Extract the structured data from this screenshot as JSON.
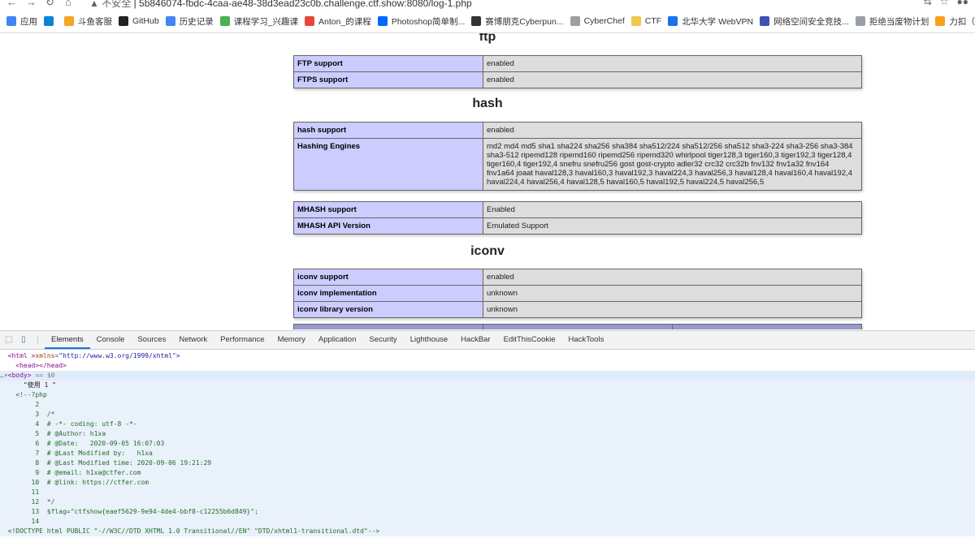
{
  "browser": {
    "security_label": "不安全",
    "url": "5b846074-fbdc-4caa-ae48-38d3ead23c0b.challenge.ctf.show:8080/log-1.php"
  },
  "bookmarks": [
    {
      "label": "应用",
      "icon": "apps-grid-icon",
      "color": "#4285f4"
    },
    {
      "label": "",
      "icon": "bing-icon",
      "color": "#0a84d6"
    },
    {
      "label": "斗鱼客服",
      "icon": "douyu-icon",
      "color": "#f5a623"
    },
    {
      "label": "GitHub",
      "icon": "github-icon",
      "color": "#222222"
    },
    {
      "label": "历史记录",
      "icon": "history-icon",
      "color": "#4285f4"
    },
    {
      "label": "课程学习_兴趣课",
      "icon": "course-icon",
      "color": "#4caf50"
    },
    {
      "label": "Anton_的课程",
      "icon": "flame-icon",
      "color": "#e8453c"
    },
    {
      "label": "Photoshop简单制...",
      "icon": "zhihu-icon",
      "color": "#0066ff"
    },
    {
      "label": "赛博朋克Cyberpun...",
      "icon": "cyberpunk-icon",
      "color": "#333333"
    },
    {
      "label": "CyberChef",
      "icon": "cyberchef-icon",
      "color": "#9aa0a6"
    },
    {
      "label": "CTF",
      "icon": "folder-icon",
      "color": "#f2c94c"
    },
    {
      "label": "北华大学 WebVPN",
      "icon": "lock-icon",
      "color": "#1a73e8"
    },
    {
      "label": "网络空间安全竞技...",
      "icon": "shield-icon",
      "color": "#3f51b5"
    },
    {
      "label": "拒绝当废物计划",
      "icon": "page-icon",
      "color": "#9aa0a6"
    },
    {
      "label": "力扣（LeetCode",
      "icon": "leetcode-icon",
      "color": "#f89f1b"
    }
  ],
  "php_info": {
    "ftp": {
      "title": "ftp",
      "rows": [
        {
          "name": "FTP support",
          "value": "enabled"
        },
        {
          "name": "FTPS support",
          "value": "enabled"
        }
      ]
    },
    "hash": {
      "title": "hash",
      "rows": [
        {
          "name": "hash support",
          "value": "enabled"
        },
        {
          "name": "Hashing Engines",
          "value": "md2 md4 md5 sha1 sha224 sha256 sha384 sha512/224 sha512/256 sha512 sha3-224 sha3-256 sha3-384 sha3-512 ripemd128 ripemd160 ripemd256 ripemd320 whirlpool tiger128,3 tiger160,3 tiger192,3 tiger128,4 tiger160,4 tiger192,4 snefru snefru256 gost gost-crypto adler32 crc32 crc32b fnv132 fnv1a32 fnv164 fnv1a64 joaat haval128,3 haval160,3 haval192,3 haval224,3 haval256,3 haval128,4 haval160,4 haval192,4 haval224,4 haval256,4 haval128,5 haval160,5 haval192,5 haval224,5 haval256,5"
        }
      ],
      "mhash_rows": [
        {
          "name": "MHASH support",
          "value": "Enabled"
        },
        {
          "name": "MHASH API Version",
          "value": "Emulated Support"
        }
      ]
    },
    "iconv": {
      "title": "iconv",
      "rows": [
        {
          "name": "iconv support",
          "value": "enabled"
        },
        {
          "name": "iconv implementation",
          "value": "unknown"
        },
        {
          "name": "iconv library version",
          "value": "unknown"
        }
      ]
    }
  },
  "devtools": {
    "tabs": [
      "Elements",
      "Console",
      "Sources",
      "Network",
      "Performance",
      "Memory",
      "Application",
      "Security",
      "Lighthouse",
      "HackBar",
      "EditThisCookie",
      "HackTools"
    ],
    "active_tab": "Elements",
    "dom": {
      "html_open": "<html xmlns=\"http://www.w3.org/1999/xhtml\">",
      "head": "<head></head>",
      "body_open": "<body>",
      "body_selected_marker": "== $0",
      "text_node": "\"使用 1 \"",
      "comment_open": "<!--?php",
      "code_lines": [
        {
          "n": "2",
          "text": ""
        },
        {
          "n": "3",
          "text": "/*"
        },
        {
          "n": "4",
          "text": "# -*- coding: utf-8 -*-"
        },
        {
          "n": "5",
          "text": "# @Author: h1xa"
        },
        {
          "n": "6",
          "text": "# @Date:   2020-09-05 16:07:03"
        },
        {
          "n": "7",
          "text": "# @Last Modified by:   h1xa"
        },
        {
          "n": "8",
          "text": "# @Last Modified time: 2020-09-06 19:21:29"
        },
        {
          "n": "9",
          "text": "# @email: h1xa@ctfer.com"
        },
        {
          "n": "10",
          "text": "# @link: https://ctfer.com"
        },
        {
          "n": "11",
          "text": ""
        },
        {
          "n": "12",
          "text": "*/"
        },
        {
          "n": "13",
          "text": "$flag=\"ctfshow{eaef5629-9e94-4de4-bbf8-c12255b6d849}\";"
        },
        {
          "n": "14",
          "text": ""
        }
      ],
      "doctype_line": "<!DOCTYPE html PUBLIC \"-//W3C//DTD XHTML 1.0 Transitional//EN\" \"DTD/xhtml1-transitional.dtd\"-->"
    }
  }
}
